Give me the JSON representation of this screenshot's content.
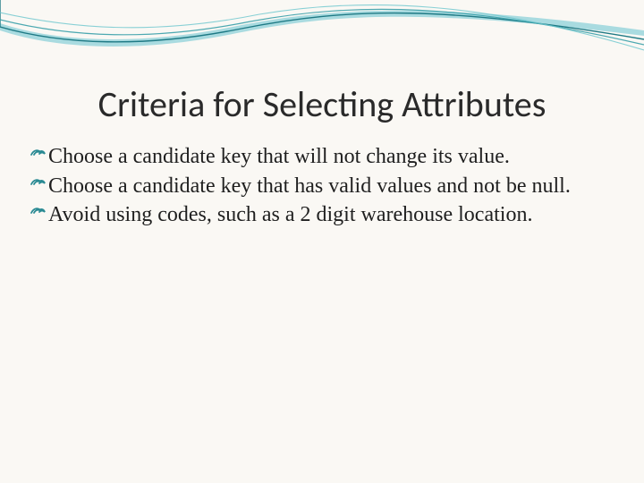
{
  "title": "Criteria for Selecting Attributes",
  "bullets": [
    {
      "glyph": "༌",
      "text": "Choose a candidate key that will not change its value."
    },
    {
      "glyph": "༌",
      "text": "Choose a candidate key that has valid values and not be null."
    },
    {
      "glyph": "༌",
      "text": "Avoid using codes, such as a 2 digit warehouse location."
    }
  ],
  "theme": {
    "wave_fill": "#8fd4da",
    "wave_stroke": "#1f7a85",
    "accent": "#2a8a93"
  }
}
